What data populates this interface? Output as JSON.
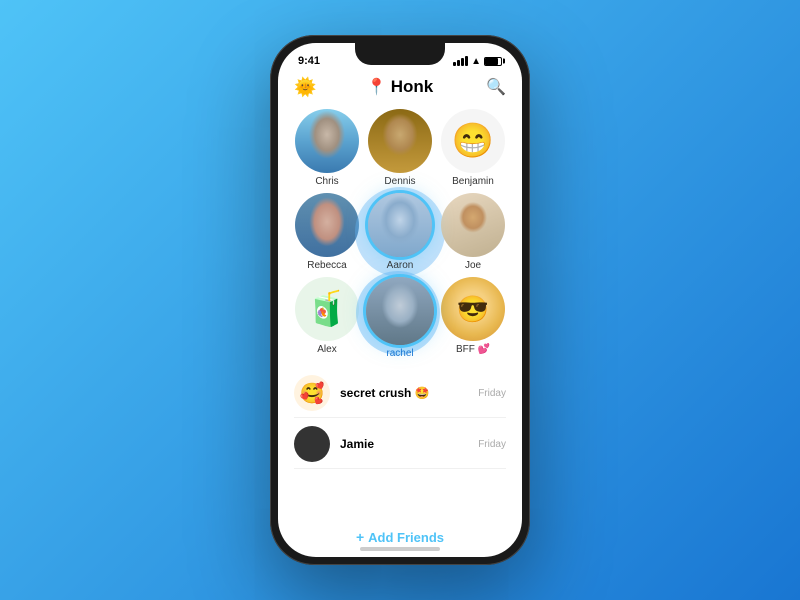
{
  "app": {
    "name": "Honk",
    "icon": "📍"
  },
  "status_bar": {
    "time": "9:41",
    "signal": true,
    "wifi": true,
    "battery": true
  },
  "header": {
    "left_icon": "🌞",
    "title": "Honk",
    "title_icon": "📍",
    "search_icon": "search"
  },
  "contacts": [
    {
      "id": "chris",
      "name": "Chris",
      "avatar_type": "photo",
      "selected": false
    },
    {
      "id": "dennis",
      "name": "Dennis",
      "avatar_type": "photo",
      "selected": false
    },
    {
      "id": "benjamin",
      "name": "Benjamin",
      "avatar_type": "emoji",
      "emoji": "😁",
      "selected": false
    },
    {
      "id": "rebecca",
      "name": "Rebecca",
      "avatar_type": "photo",
      "selected": false
    },
    {
      "id": "aaron",
      "name": "Aaron",
      "avatar_type": "photo",
      "selected": true
    },
    {
      "id": "joe",
      "name": "Joe",
      "avatar_type": "photo",
      "selected": false
    },
    {
      "id": "alex",
      "name": "Alex",
      "avatar_type": "emoji",
      "emoji": "🧃",
      "selected": false
    },
    {
      "id": "rachel",
      "name": "rachel",
      "avatar_type": "photo",
      "selected": true
    },
    {
      "id": "bff",
      "name": "BFF 💕",
      "avatar_type": "emoji",
      "emoji": "😎",
      "selected": false
    }
  ],
  "messages": [
    {
      "id": "secret_crush",
      "name": "secret crush 🤩",
      "time": "Friday",
      "avatar_type": "emoji",
      "emoji": "🥰"
    },
    {
      "id": "jamie",
      "name": "Jamie",
      "time": "Friday",
      "avatar_type": "dark"
    }
  ],
  "add_friends": {
    "label": "+ Add Friends"
  }
}
